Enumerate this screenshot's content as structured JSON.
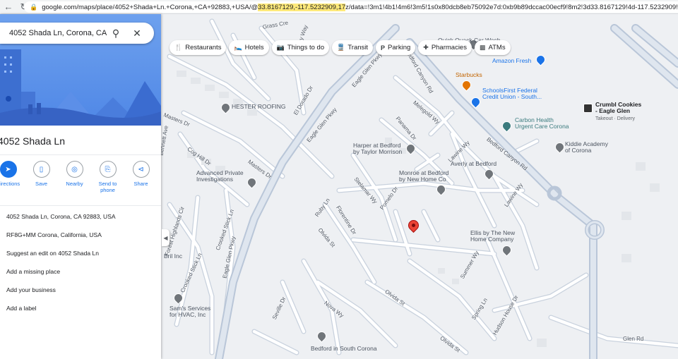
{
  "browser": {
    "url_before": "google.com/maps/place/4052+Shada+Ln.+Corona,+CA+92883,+USA/@",
    "url_highlight": "33.8167129,-117.5232909,17",
    "url_after": "z/data=!3m1!4b1!4m6!3m5!1s0x80dcb8eb75092e7d:0xb9b89dccac00ecf9!8m2!3d33.8167129!4d-117.5232909!16s%2Fg%2F...",
    "icons": [
      "back-icon",
      "refresh-icon",
      "lock-icon"
    ]
  },
  "search": {
    "value": "4052 Shada Ln, Corona, CA 92883",
    "icons": [
      "search-icon",
      "close-icon"
    ]
  },
  "place": {
    "title": "4052 Shada Ln",
    "actions": [
      {
        "label": "Directions",
        "icon": "directions-icon"
      },
      {
        "label": "Save",
        "icon": "bookmark-icon"
      },
      {
        "label": "Nearby",
        "icon": "nearby-icon"
      },
      {
        "label": "Send to\nphone",
        "icon": "send-to-phone-icon"
      },
      {
        "label": "Share",
        "icon": "share-icon"
      }
    ],
    "info": [
      "4052 Shada Ln, Corona, CA 92883, USA",
      "RF8G+MM Corona, California, USA",
      "Suggest an edit on 4052 Shada Ln",
      "Add a missing place",
      "Add your business",
      "Add a label"
    ]
  },
  "chips": [
    {
      "label": "Restaurants",
      "icon": "fork-knife-icon"
    },
    {
      "label": "Hotels",
      "icon": "bed-icon"
    },
    {
      "label": "Things to do",
      "icon": "camera-icon"
    },
    {
      "label": "Transit",
      "icon": "train-icon"
    },
    {
      "label": "Parking",
      "icon": "parking-icon"
    },
    {
      "label": "Pharmacies",
      "icon": "pharmacy-icon"
    },
    {
      "label": "ATMs",
      "icon": "atm-icon"
    }
  ],
  "pois": [
    {
      "name": "Quick Quack Car Wash",
      "color": "gray"
    },
    {
      "name": "Amazon Fresh",
      "color": "blue"
    },
    {
      "name": "Starbucks",
      "color": "orange"
    },
    {
      "name": "SchoolsFirst Federal\nCredit Union - South...",
      "color": "blue"
    },
    {
      "name": "Crumbl Cookies\n- Eagle Glen",
      "sub": "Takeout · Delivery",
      "color": "dark"
    },
    {
      "name": "Carbon Health\nUrgent Care Corona",
      "color": "teal"
    },
    {
      "name": "Kiddie Academy\nof Corona",
      "color": "gray"
    },
    {
      "name": "HESTER ROOFING",
      "color": "gray"
    },
    {
      "name": "Harper at Bedford\nby Taylor Morrison",
      "color": "gray"
    },
    {
      "name": "Monroe at Bedford\nby New Home Co",
      "color": "gray"
    },
    {
      "name": "Averly at Bedford",
      "color": "gray"
    },
    {
      "name": "Advanced Private\nInvestigations",
      "color": "gray"
    },
    {
      "name": "Ellis by The New\nHome Company",
      "color": "gray"
    },
    {
      "name": "Bril Inc",
      "color": "gray"
    },
    {
      "name": "Sam's Services\nfor HVAC, Inc",
      "color": "gray"
    },
    {
      "name": "Bedford in South Corona",
      "color": "gray"
    }
  ],
  "streets": [
    "Masters Dr",
    "Masters Dr",
    "Bennett Ave",
    "Cog Hill Dr",
    "El Dorado Dr",
    "Eagle Glen Pkwy",
    "Eagle Glen Pkwy",
    "Eagle Glen Pkwy",
    "Bedford Canyon Rd",
    "Bedford Canyon Rd",
    "Melegold Wy",
    "Panama Dr",
    "Lawine Wy",
    "Lawine Wy",
    "Stelamar Wy",
    "Pomelo Dr",
    "Ruby Ln",
    "Florentine Dr",
    "Olvida St",
    "Olvida St",
    "Olvida St",
    "Summer Wy",
    "Spring Ln",
    "Hudson House Dr",
    "Crooked Stick Ln",
    "Crooked Stick Ln",
    "Forest Highlands Cir",
    "Seville Dr",
    "Nova Wy",
    "Glen Rd",
    "Grass Cre",
    "Valley Way"
  ]
}
